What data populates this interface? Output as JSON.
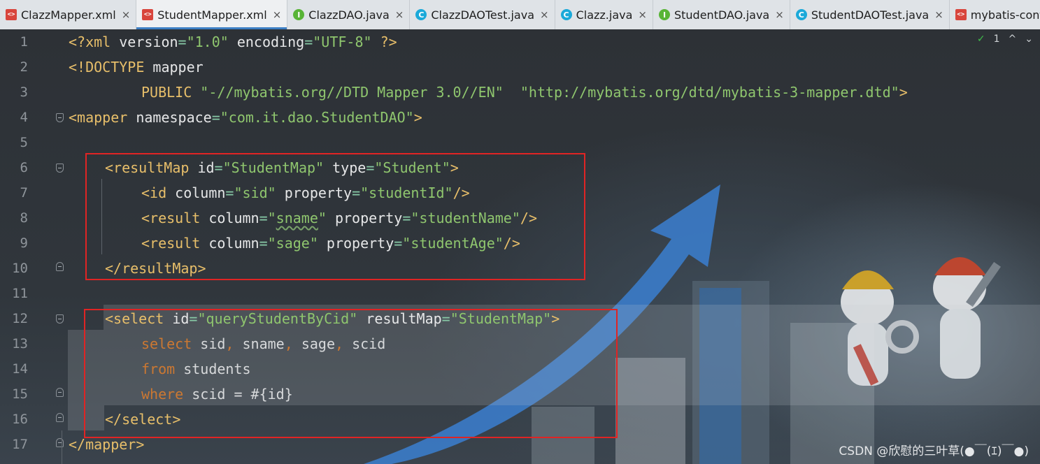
{
  "tabs": [
    {
      "label": "ClazzMapper.xml",
      "icon": "xml-file-icon",
      "active": false
    },
    {
      "label": "StudentMapper.xml",
      "icon": "xml-file-icon",
      "active": true
    },
    {
      "label": "ClazzDAO.java",
      "icon": "interface-icon",
      "active": false
    },
    {
      "label": "ClazzDAOTest.java",
      "icon": "class-icon",
      "active": false
    },
    {
      "label": "Clazz.java",
      "icon": "class-icon",
      "active": false
    },
    {
      "label": "StudentDAO.java",
      "icon": "interface-icon",
      "active": false
    },
    {
      "label": "StudentDAOTest.java",
      "icon": "class-icon",
      "active": false
    },
    {
      "label": "mybatis-config.xr",
      "icon": "xml-file-icon",
      "active": false
    }
  ],
  "tab_close_glyph": "×",
  "inspection": {
    "check": "✓",
    "count": "1",
    "up": "^",
    "down": "⌄"
  },
  "line_numbers": [
    "1",
    "2",
    "3",
    "4",
    "5",
    "6",
    "7",
    "8",
    "9",
    "10",
    "11",
    "12",
    "13",
    "14",
    "15",
    "16",
    "17"
  ],
  "code": {
    "l1": {
      "a": "<?xml ",
      "b": "version",
      "c": "=",
      "d": "\"1.0\"",
      "e": " encoding",
      "f": "=",
      "g": "\"UTF-8\"",
      "h": " ?>"
    },
    "l2": {
      "a": "<!DOCTYPE ",
      "b": "mapper"
    },
    "l3": {
      "a": "PUBLIC ",
      "b": "\"-//mybatis.org//DTD Mapper 3.0//EN\"",
      "c": "  \"http://mybatis.org/dtd/mybatis-3-mapper.dtd\"",
      "d": ">"
    },
    "l4": {
      "a": "<mapper ",
      "b": "namespace",
      "c": "=",
      "d": "\"com.it.dao.StudentDAO\"",
      "e": ">"
    },
    "l6": {
      "a": "<resultMap ",
      "b": "id",
      "c": "=",
      "d": "\"StudentMap\"",
      "e": " type",
      "f": "=",
      "g": "\"Student\"",
      "h": ">"
    },
    "l7": {
      "a": "<id ",
      "b": "column",
      "c": "=",
      "d": "\"sid\"",
      "e": " property",
      "f": "=",
      "g": "\"studentId\"",
      "h": "/>"
    },
    "l8": {
      "a": "<result ",
      "b": "column",
      "c": "=",
      "d1": "\"",
      "d2": "sname",
      "d3": "\"",
      "e": " property",
      "f": "=",
      "g": "\"studentName\"",
      "h": "/>"
    },
    "l9": {
      "a": "<result ",
      "b": "column",
      "c": "=",
      "d": "\"sage\"",
      "e": " property",
      "f": "=",
      "g": "\"studentAge\"",
      "h": "/>"
    },
    "l10": {
      "a": "</resultMap>"
    },
    "l12": {
      "a": "<select ",
      "b": "id",
      "c": "=",
      "d": "\"queryStudentByCid\"",
      "e": " resultMap",
      "f": "=",
      "g": "\"StudentMap\"",
      "h": ">"
    },
    "l13": {
      "a": "select ",
      "b": "sid",
      ",1": ", ",
      "c": "sname",
      ",2": ", ",
      "d": "sage",
      ",3": ", ",
      "e": "scid"
    },
    "l14": {
      "a": "from ",
      "b": "students"
    },
    "l15": {
      "a": "where ",
      "b": "scid = #{id}"
    },
    "l16": {
      "a": "</select>"
    },
    "l17": {
      "a": "</mapper>"
    }
  },
  "watermark": "CSDN @欣慰的三叶草(●￣(ｴ)￣●)",
  "colors": {
    "tag": "#e8bf6a",
    "string": "#8fc66e",
    "keyword": "#cc7832",
    "highlight_box": "#e02424"
  }
}
